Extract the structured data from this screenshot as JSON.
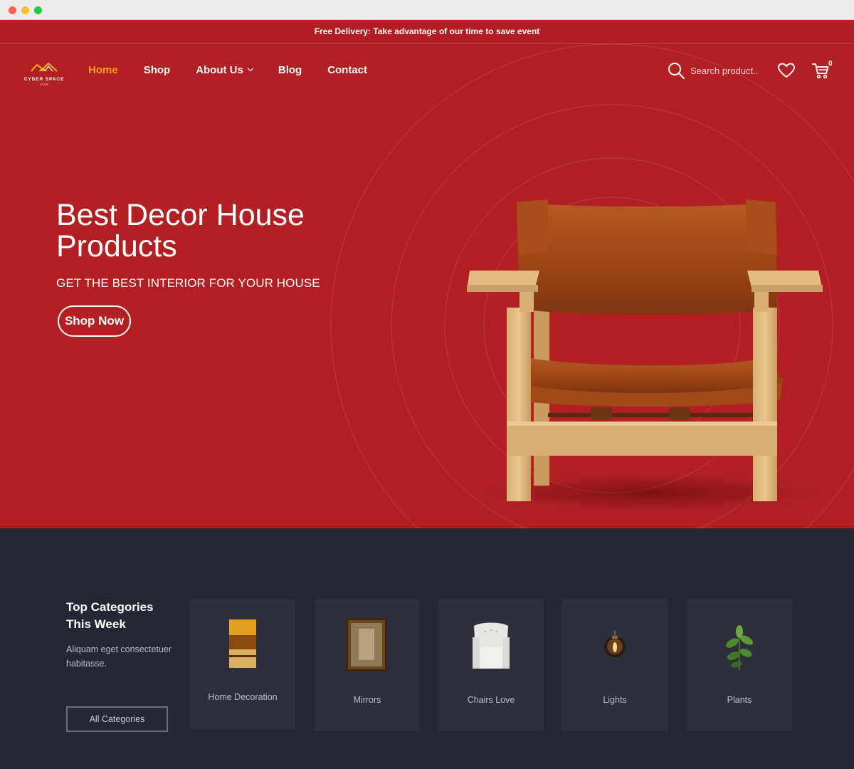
{
  "announcement": "Free Delivery: Take advantage of our time to save event",
  "brand": {
    "name": "CYBER SPACE",
    "tagline": "STORE"
  },
  "nav": [
    {
      "label": "Home",
      "active": true
    },
    {
      "label": "Shop"
    },
    {
      "label": "About Us",
      "has_dropdown": true
    },
    {
      "label": "Blog"
    },
    {
      "label": "Contact"
    }
  ],
  "search": {
    "placeholder": "Search product.."
  },
  "cart": {
    "count": "0"
  },
  "hero": {
    "title": "Best Decor House Products",
    "subtitle": "GET THE BEST INTERIOR FOR YOUR HOUSE",
    "cta": "Shop Now"
  },
  "categories": {
    "title": "Top Categories This Week",
    "description": "Aliquam eget consectetuer habitasse.",
    "all_button": "All Categories",
    "items": [
      {
        "label": "Home Decoration",
        "icon": "painting-icon"
      },
      {
        "label": "Mirrors",
        "icon": "mirror-icon"
      },
      {
        "label": "Chairs Love",
        "icon": "armchair-icon"
      },
      {
        "label": "Lights",
        "icon": "pendant-lamp-icon"
      },
      {
        "label": "Plants",
        "icon": "plant-icon"
      }
    ]
  },
  "colors": {
    "hero_red": "#b22024",
    "accent_orange": "#ff9f1a",
    "dark_bg": "#252834",
    "card_bg": "#2d303c"
  }
}
